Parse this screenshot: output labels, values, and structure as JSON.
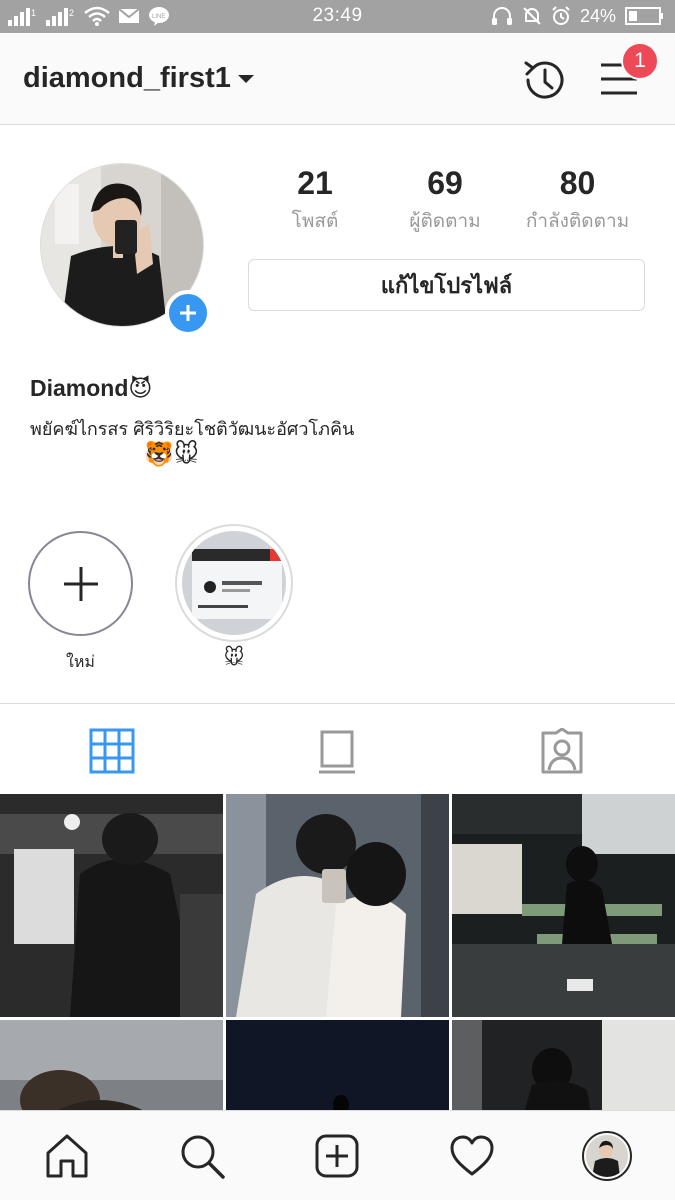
{
  "status_bar": {
    "time": "23:49",
    "battery_percent": "24%",
    "left_icons": [
      "signal-icon",
      "signal-icon",
      "wifi-icon",
      "mail-icon",
      "line-icon"
    ],
    "right_icons": [
      "headset-icon",
      "mute-icon",
      "alarm-icon",
      "battery-icon"
    ]
  },
  "header": {
    "username": "diamond_first1",
    "menu_badge": "1"
  },
  "profile": {
    "stats": [
      {
        "value": "21",
        "label": "โพสต์"
      },
      {
        "value": "69",
        "label": "ผู้ติดตาม"
      },
      {
        "value": "80",
        "label": "กำลังติดตาม"
      }
    ],
    "edit_button": "แก้ไขโปรไฟล์",
    "display_name": "Diamond😈",
    "bio": "พยัคฆ์ไกรสร ศิริวิริยะโชติวัฒนะอัศวโภคิน",
    "bio_emoji": "🐯🐭"
  },
  "highlights": {
    "new_label": "ใหม่",
    "items": [
      {
        "label": "🐭"
      }
    ]
  },
  "tabs": [
    "grid-icon",
    "feed-icon",
    "tagged-icon"
  ],
  "bottom_nav": [
    "home-icon",
    "search-icon",
    "add-post-icon",
    "heart-icon",
    "profile-avatar"
  ]
}
